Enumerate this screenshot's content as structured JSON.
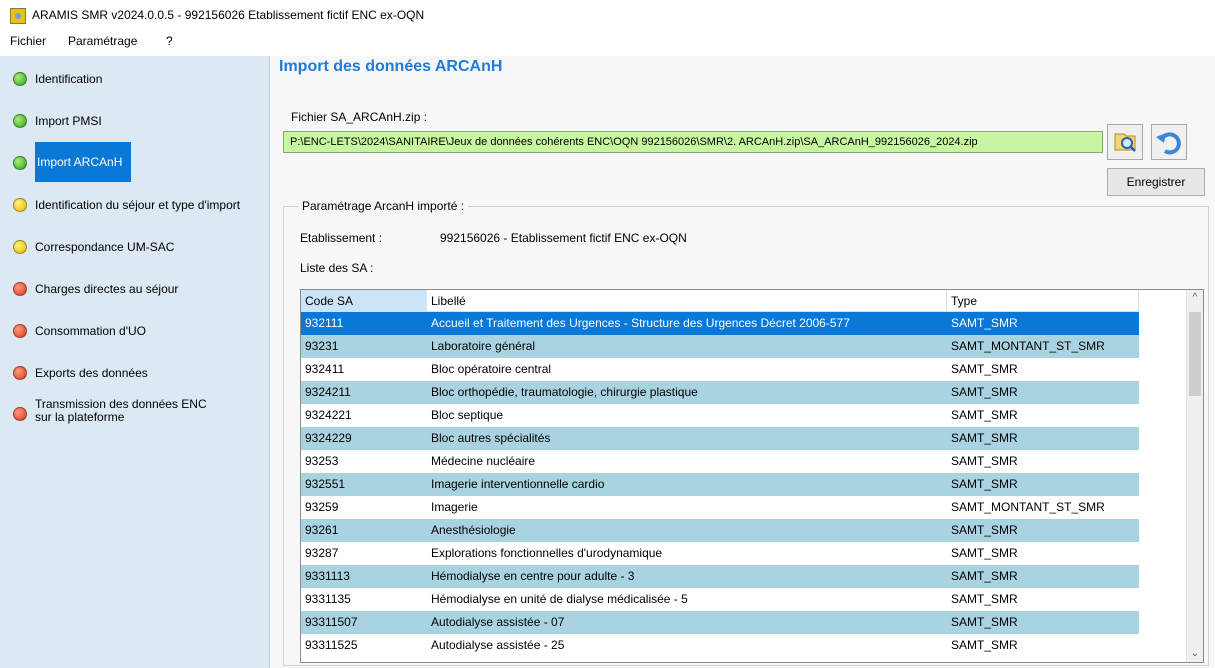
{
  "window": {
    "title": "ARAMIS SMR v2024.0.0.5  -  992156026  Etablissement fictif ENC ex-OQN"
  },
  "menu": {
    "items": [
      "Fichier",
      "Paramétrage",
      "?"
    ]
  },
  "sidebar": {
    "items": [
      {
        "label": "Identification",
        "status": "green"
      },
      {
        "label": "Import PMSI",
        "status": "green"
      },
      {
        "label": "Import ARCAnH",
        "status": "green",
        "selected": true
      },
      {
        "label": "Identification du séjour et type d'import",
        "status": "yellow"
      },
      {
        "label": "Correspondance UM-SAC",
        "status": "yellow"
      },
      {
        "label": "Charges directes au séjour",
        "status": "red"
      },
      {
        "label": "Consommation d'UO",
        "status": "red"
      },
      {
        "label": "Exports des données",
        "status": "red"
      },
      {
        "label_line1": "Transmission des données ENC",
        "label_line2": "sur la plateforme",
        "status": "red"
      }
    ]
  },
  "main": {
    "title": "Import des données ARCAnH",
    "file_label": "Fichier SA_ARCAnH.zip :",
    "file_path": "P:\\ENC-LETS\\2024\\SANITAIRE\\Jeux de données cohérents ENC\\OQN 992156026\\SMR\\2. ARCAnH.zip\\SA_ARCAnH_992156026_2024.zip",
    "save_label": "Enregistrer",
    "group_title": "Paramétrage ArcanH importé :",
    "establishment_label": "Etablissement :",
    "establishment_value": "992156026 - Etablissement fictif ENC ex-OQN",
    "sa_list_label": "Liste des SA :"
  },
  "table": {
    "columns": [
      "Code SA",
      "Libellé",
      "Type"
    ],
    "rows": [
      [
        "932111",
        "Accueil et Traitement des Urgences - Structure des Urgences Décret 2006-577",
        "SAMT_SMR"
      ],
      [
        "93231",
        "Laboratoire général",
        "SAMT_MONTANT_ST_SMR"
      ],
      [
        "932411",
        "Bloc opératoire central",
        "SAMT_SMR"
      ],
      [
        "9324211",
        "Bloc orthopédie, traumatologie, chirurgie plastique",
        "SAMT_SMR"
      ],
      [
        "9324221",
        "Bloc septique",
        "SAMT_SMR"
      ],
      [
        "9324229",
        "Bloc autres spécialités",
        "SAMT_SMR"
      ],
      [
        "93253",
        "Médecine nucléaire",
        "SAMT_SMR"
      ],
      [
        "932551",
        "Imagerie interventionnelle cardio",
        "SAMT_SMR"
      ],
      [
        "93259",
        "Imagerie",
        "SAMT_MONTANT_ST_SMR"
      ],
      [
        "93261",
        "Anesthésiologie",
        "SAMT_SMR"
      ],
      [
        "93287",
        "Explorations fonctionnelles d'urodynamique",
        "SAMT_SMR"
      ],
      [
        "9331113",
        "Hémodialyse en centre pour adulte - 3",
        "SAMT_SMR"
      ],
      [
        "9331135",
        "Hémodialyse en unité de dialyse médicalisée - 5",
        "SAMT_SMR"
      ],
      [
        "93311507",
        "Autodialyse assistée - 07",
        "SAMT_SMR"
      ],
      [
        "93311525",
        "Autodialyse assistée - 25",
        "SAMT_SMR"
      ]
    ],
    "selected_row": 0
  },
  "colors": {
    "accent": "#0a78d7",
    "title": "#1f7bd4",
    "row_alt": "#a9d3e1",
    "path_bg": "#c8f5a0",
    "sidebar_bg": "#dce8f3"
  }
}
